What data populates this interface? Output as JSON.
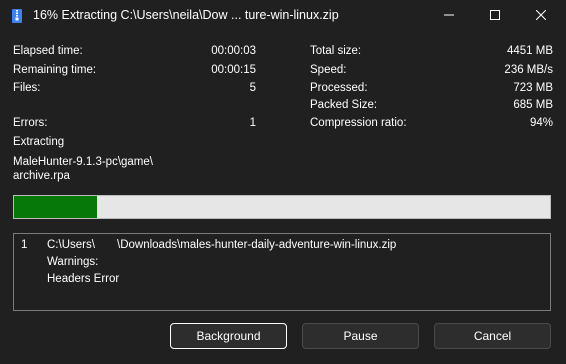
{
  "window": {
    "title": "16% Extracting C:\\Users\\neila\\Dow ... ture-win-linux.zip"
  },
  "stats_left": [
    {
      "label": "Elapsed time:",
      "value": "00:00:03"
    },
    {
      "label": "Remaining time:",
      "value": "00:00:15"
    },
    {
      "label": "Files:",
      "value": "5"
    },
    {
      "label": "Errors:",
      "value": "1"
    }
  ],
  "stats_right": [
    {
      "label": "Total size:",
      "value": "4451 MB"
    },
    {
      "label": "Speed:",
      "value": "236 MB/s"
    },
    {
      "label": "Processed:",
      "value": "723 MB"
    },
    {
      "label": "Packed Size:",
      "value": "685 MB"
    },
    {
      "label": "Compression ratio:",
      "value": "94%"
    }
  ],
  "operation": {
    "label": "Extracting",
    "current_path": "MaleHunter-9.1.3-pc\\game\\",
    "current_file": "archive.rpa"
  },
  "progress": {
    "fraction": 0.155,
    "fill_color": "#06780a"
  },
  "messages": {
    "index": "1",
    "path_start": "C:\\Users\\",
    "path_end": "\\Downloads\\males-hunter-daily-adventure-win-linux.zip",
    "warnings": "Warnings:",
    "error": "Headers Error"
  },
  "buttons": {
    "background": "Background",
    "pause": "Pause",
    "cancel": "Cancel"
  },
  "icons": {
    "app": "zip-archive-icon",
    "minimize": "minimize-icon",
    "maximize": "maximize-icon",
    "close": "close-icon"
  }
}
